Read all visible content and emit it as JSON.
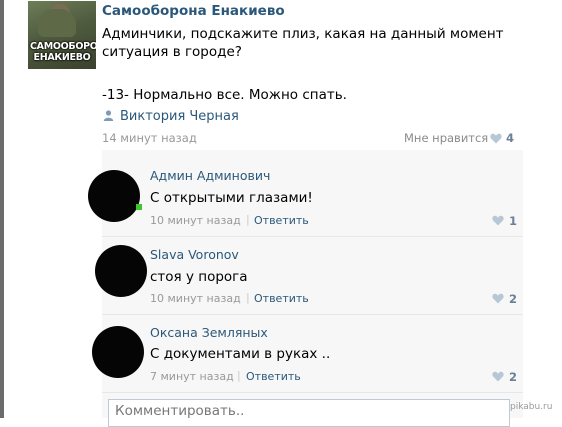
{
  "post": {
    "author": "Самооборона Енакиево",
    "avatar_caption": "САМООБОРОНА\nЕНАКИЕВО",
    "text_line_1": "Админчики, подскажите плиз, какая на данный момент",
    "text_line_2": "ситуация в городе?",
    "text_line_3": "-13- Нормально все. Можно спать.",
    "signer": "Виктория Черная",
    "signer_icon": "person-icon",
    "time": "14 минут назад",
    "like_label": "Мне нравится",
    "like_icon": "heart-icon",
    "like_count": "4"
  },
  "comments": [
    {
      "author": "Админ Админович",
      "text": "С открытыми глазами!",
      "time": "10 минут назад",
      "separator": "|",
      "reply": "Ответить",
      "likes": "1",
      "online": true
    },
    {
      "author": "Slava Voronov",
      "text": "стоя у порога",
      "time": "10 минут назад",
      "separator": "|",
      "reply": "Ответить",
      "likes": "2",
      "online": false
    },
    {
      "author": "Оксана Земляных",
      "text": "С документами в руках ..",
      "time": "7 минут назад",
      "separator": "|",
      "reply": "Ответить",
      "likes": "2",
      "online": false
    }
  ],
  "comment_box": {
    "placeholder": "Комментировать.."
  },
  "watermark": "pikabu.ru",
  "colors": {
    "link": "#2b587a",
    "muted": "#999999",
    "like_count": "#6b7f97",
    "online": "#3fc32f",
    "comments_bg": "#f7f7f7"
  }
}
